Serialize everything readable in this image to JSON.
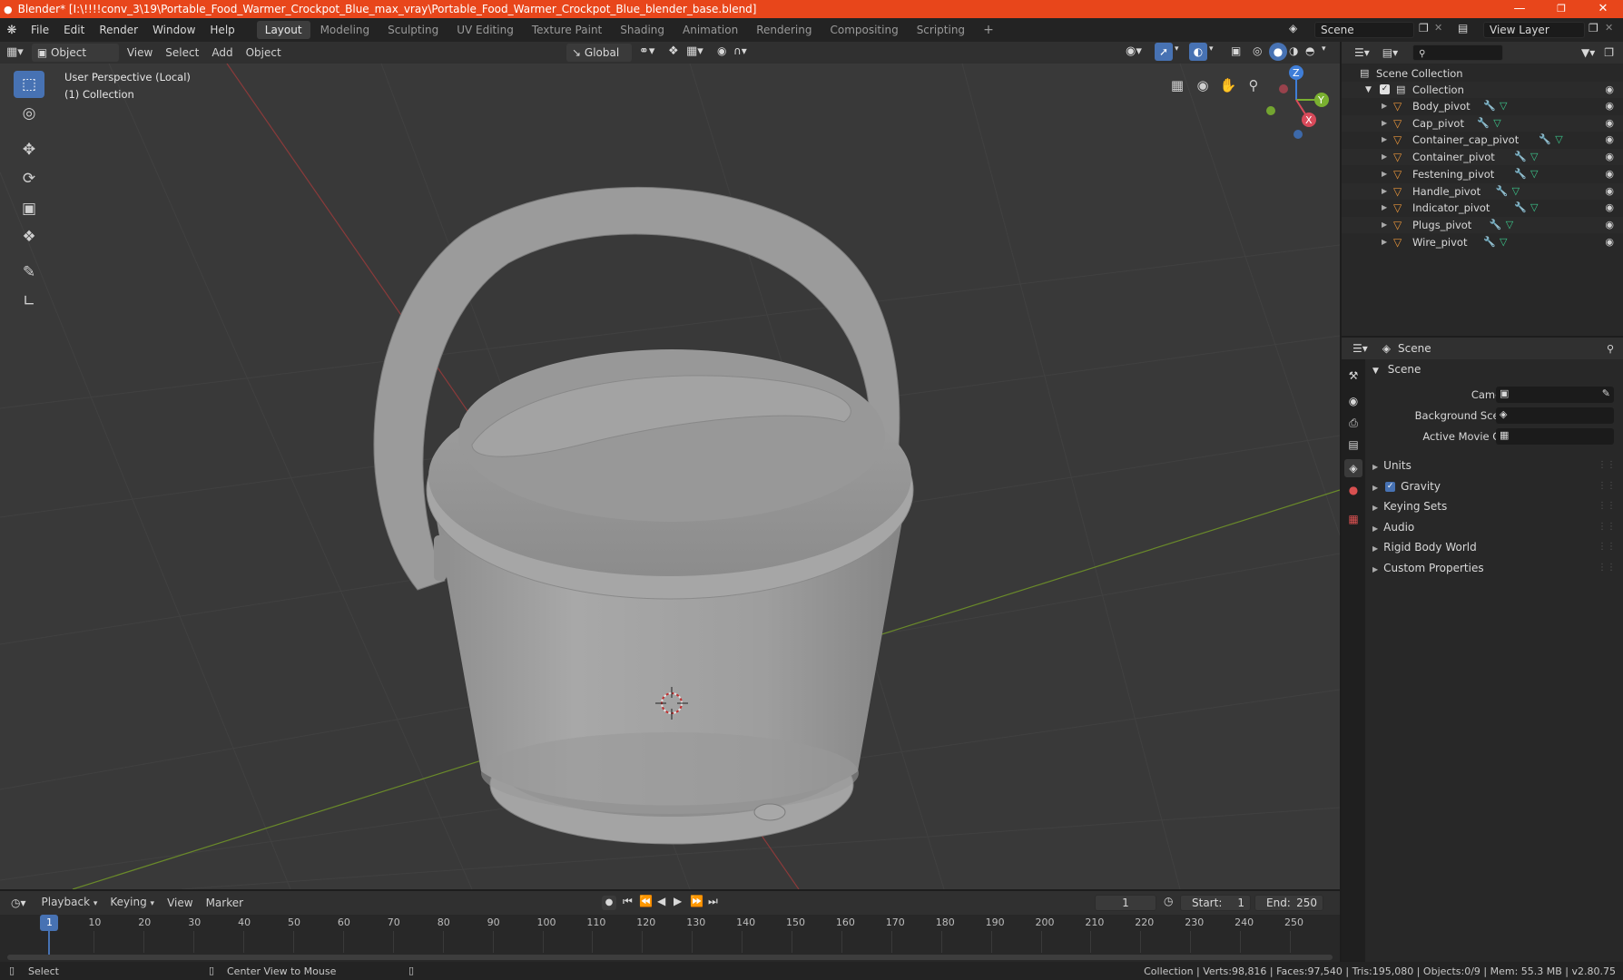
{
  "titlebar": {
    "title": "Blender* [I:\\!!!!conv_3\\19\\Portable_Food_Warmer_Crockpot_Blue_max_vray\\Portable_Food_Warmer_Crockpot_Blue_blender_base.blend]",
    "minimize": "—",
    "restore": "❐",
    "close": "✕"
  },
  "menubar": {
    "menus": [
      "File",
      "Edit",
      "Render",
      "Window",
      "Help"
    ],
    "workspaces": [
      "Layout",
      "Modeling",
      "Sculpting",
      "UV Editing",
      "Texture Paint",
      "Shading",
      "Animation",
      "Rendering",
      "Compositing",
      "Scripting"
    ],
    "add_workspace": "+",
    "scene_name": "Scene",
    "view_layer": "View Layer"
  },
  "viewport_header": {
    "mode": "Object Mode",
    "menus": [
      "View",
      "Select",
      "Add",
      "Object"
    ],
    "orientation": "Global"
  },
  "viewport": {
    "perspective_label": "User Perspective (Local)",
    "collection_label": "(1) Collection",
    "gizmo_axes": [
      "Z",
      "Y",
      "X"
    ]
  },
  "outliner": {
    "root": "Scene Collection",
    "collection": "Collection",
    "objects": [
      "Body_pivot",
      "Cap_pivot",
      "Container_cap_pivot",
      "Container_pivot",
      "Festening_pivot",
      "Handle_pivot",
      "Indicator_pivot",
      "Plugs_pivot",
      "Wire_pivot"
    ]
  },
  "properties": {
    "header_title": "Scene",
    "panel_title": "Scene",
    "camera_label": "Camera",
    "background_scene_label": "Background Scene",
    "active_movie_clip_label": "Active Movie Clip",
    "subpanels": [
      "Units",
      "Gravity",
      "Keying Sets",
      "Audio",
      "Rigid Body World",
      "Custom Properties"
    ],
    "gravity_checked": true
  },
  "timeline": {
    "menus": [
      "Playback",
      "Keying",
      "View",
      "Marker"
    ],
    "current_frame": "1",
    "start_label": "Start:",
    "start_value": "1",
    "end_label": "End:",
    "end_value": "250",
    "ticks": [
      "1",
      "10",
      "20",
      "30",
      "40",
      "50",
      "60",
      "70",
      "80",
      "90",
      "100",
      "110",
      "120",
      "130",
      "140",
      "150",
      "160",
      "170",
      "180",
      "190",
      "200",
      "210",
      "220",
      "230",
      "240",
      "250"
    ]
  },
  "statusbar": {
    "select": "Select",
    "center_view": "Center View to Mouse",
    "stats": "Collection | Verts:98,816 | Faces:97,540 | Tris:195,080 | Objects:0/9 | Mem: 55.3 MB | v2.80.75"
  },
  "colors": {
    "titlebar": "#e8461b",
    "accent_blue": "#4772b3",
    "object_orange": "#e8953a",
    "mesh_green": "#3cc88c",
    "modifier_blue": "#5d8de0"
  }
}
